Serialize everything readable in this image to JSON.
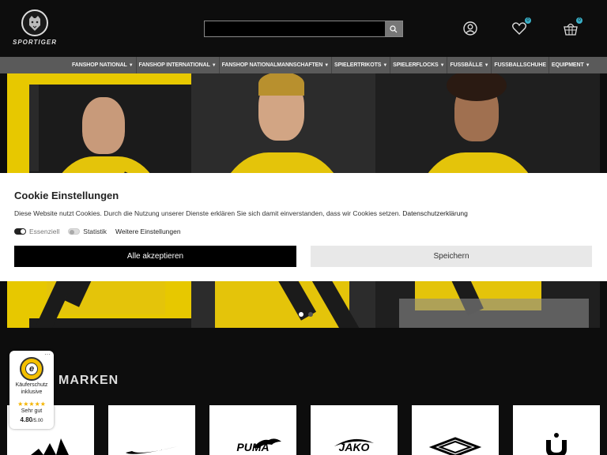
{
  "header": {
    "logo_text": "SPORTIGER",
    "search_placeholder": "",
    "wishlist_count": "0",
    "cart_count": "0"
  },
  "nav": {
    "items": [
      {
        "label": "Fanshop National"
      },
      {
        "label": "Fanshop International"
      },
      {
        "label": "Fanshop Nationalmannschaften"
      },
      {
        "label": "Spielertrikots"
      },
      {
        "label": "Spielerflocks"
      },
      {
        "label": "Fussbälle"
      },
      {
        "label": "Fussballschuhe"
      },
      {
        "label": "Equipment"
      }
    ]
  },
  "cookie": {
    "title": "Cookie Einstellungen",
    "text": "Diese Website nutzt Cookies. Durch die Nutzung unserer Dienste erklären Sie sich damit einverstanden, dass wir Cookies setzen.",
    "privacy_link": "Datenschutzerklärung",
    "toggle_essential": "Essenziell",
    "toggle_statistic": "Statistik",
    "more_settings": "Weitere Einstellungen",
    "accept_all": "Alle akzeptieren",
    "save": "Speichern"
  },
  "brands": {
    "title": "MARKEN",
    "items": [
      "adidas",
      "Nike",
      "PUMA",
      "JAKO",
      "Umbro",
      "uhlsport"
    ]
  },
  "trust": {
    "line1": "Käuferschutz",
    "line2": "inklusive",
    "stars": "★★★★★",
    "grade": "Sehr gut",
    "score": "4.80",
    "score_max": "/5.00",
    "more": "···"
  },
  "colors": {
    "accent_yellow": "#e7c800",
    "badge": "#3ab0c8"
  }
}
